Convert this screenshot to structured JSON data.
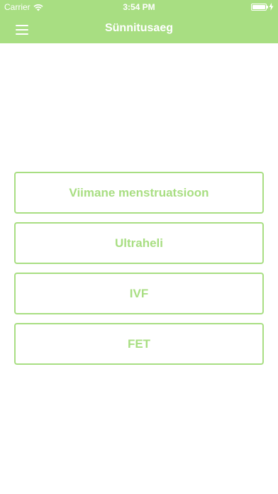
{
  "status_bar": {
    "carrier": "Carrier",
    "time": "3:54 PM",
    "wifi_icon": "wifi-icon",
    "battery_icon": "battery-icon",
    "charging_icon": "charging-icon",
    "battery_level": 1.0
  },
  "header": {
    "title": "Sünnitusaeg",
    "menu_icon": "hamburger-menu-icon",
    "background_color": "#a8de82"
  },
  "options": [
    {
      "label": "Viimane menstruatsioon"
    },
    {
      "label": "Ultraheli"
    },
    {
      "label": "IVF"
    },
    {
      "label": "FET"
    }
  ],
  "colors": {
    "accent": "#a8de82",
    "background": "#ffffff",
    "header_text": "#ffffff"
  }
}
